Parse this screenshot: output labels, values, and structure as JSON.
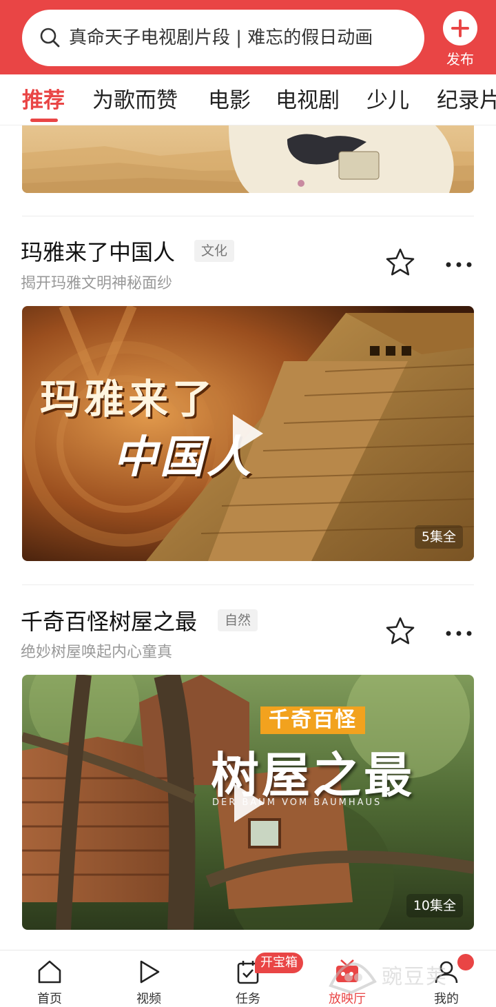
{
  "search": {
    "text": "真命天子电视剧片段 | 难忘的假日动画",
    "publish_label": "发布"
  },
  "tabs": [
    {
      "label": "推荐",
      "active": true
    },
    {
      "label": "为歌而赞",
      "active": false
    },
    {
      "label": "电影",
      "active": false
    },
    {
      "label": "电视剧",
      "active": false
    },
    {
      "label": "少儿",
      "active": false
    },
    {
      "label": "纪录片",
      "active": false
    }
  ],
  "cards": [
    {
      "title": "玛雅来了中国人",
      "tag": "文化",
      "subtitle": "揭开玛雅文明神秘面纱",
      "episodes": "5集全",
      "poster_line1": "玛雅来了",
      "poster_line2": "中国人"
    },
    {
      "title": "千奇百怪树屋之最",
      "tag": "自然",
      "subtitle": "绝妙树屋唤起内心童真",
      "episodes": "10集全",
      "poster_line1": "千奇百怪",
      "poster_line2": "树屋之最",
      "poster_line3": "DER BAUM VOM BAUMHAUS"
    }
  ],
  "bottom_nav": {
    "items": [
      {
        "label": "首页",
        "icon": "home-icon"
      },
      {
        "label": "视频",
        "icon": "play-icon"
      },
      {
        "label": "任务",
        "icon": "task-icon"
      },
      {
        "label": "放映厅",
        "icon": "theater-icon",
        "active": true
      },
      {
        "label": "我的",
        "icon": "user-icon"
      }
    ],
    "treasure_badge": "开宝箱"
  },
  "watermark": "豌豆荚",
  "colors": {
    "accent": "#e94545",
    "text_primary": "#111111",
    "text_secondary": "#999999"
  }
}
